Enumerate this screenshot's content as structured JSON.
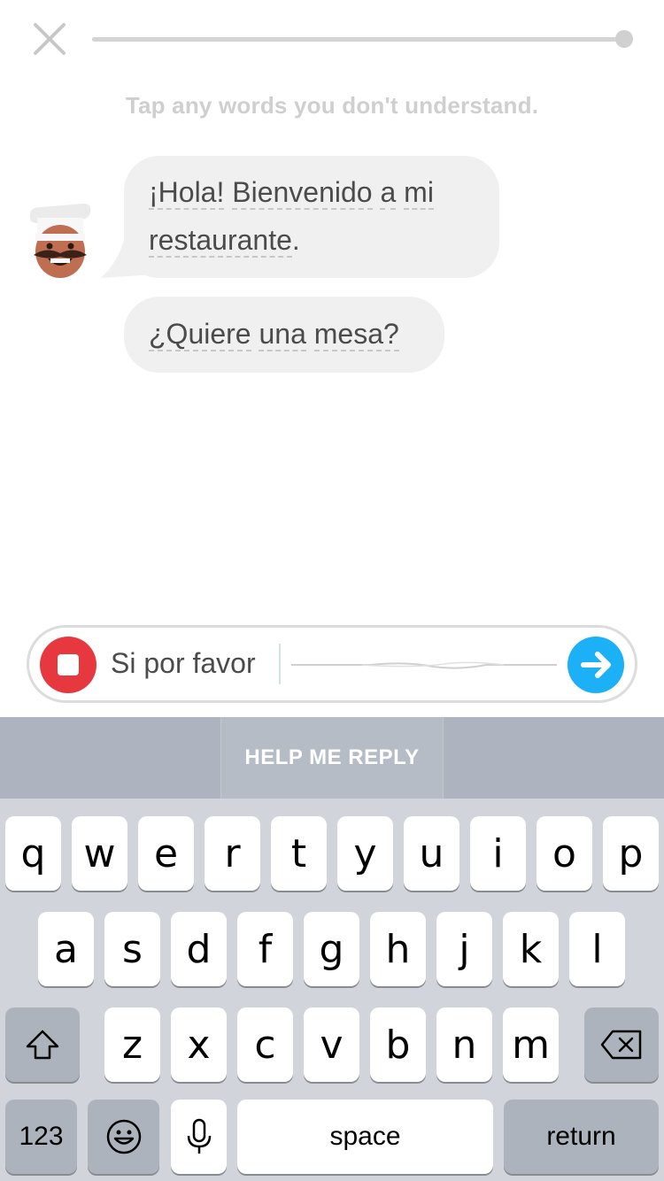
{
  "header": {
    "close_icon": "close-icon",
    "progress": 0.98
  },
  "instruction": "Tap any words you don't understand.",
  "conversation": {
    "avatar": "chef-avatar",
    "messages": [
      {
        "words": [
          "¡Hola!",
          "Bienvenido",
          "a",
          "mi",
          "restaurante"
        ],
        "trailing": "."
      },
      {
        "words": [
          "¿Quiere",
          "una",
          "mesa?"
        ],
        "trailing": ""
      }
    ]
  },
  "input": {
    "value": "Si por favor",
    "stop_icon": "stop-icon",
    "send_icon": "arrow-right-icon"
  },
  "help": {
    "label": "HELP ME REPLY"
  },
  "keyboard": {
    "row1": [
      "q",
      "w",
      "e",
      "r",
      "t",
      "y",
      "u",
      "i",
      "o",
      "p"
    ],
    "row2": [
      "a",
      "s",
      "d",
      "f",
      "g",
      "h",
      "j",
      "k",
      "l"
    ],
    "row3": [
      "z",
      "x",
      "c",
      "v",
      "b",
      "n",
      "m"
    ],
    "shift_icon": "shift-icon",
    "delete_icon": "backspace-icon",
    "numbers_label": "123",
    "emoji_icon": "emoji-icon",
    "mic_icon": "microphone-icon",
    "space_label": "space",
    "return_label": "return"
  }
}
